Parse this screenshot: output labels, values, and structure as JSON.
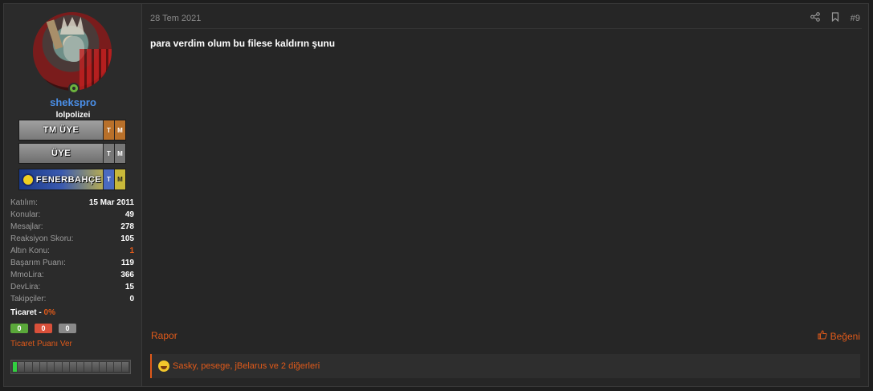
{
  "post": {
    "date": "28 Tem 2021",
    "number": "#9",
    "content": "para verdim olum bu filese kaldırın şunu",
    "report_label": "Rapor",
    "like_label": "Beğeni",
    "reactions_text": "Sasky, pesege, jBelarus ve 2 diğerleri"
  },
  "user": {
    "name": "shekspro",
    "title": "lolpolizei",
    "online": true,
    "banners": [
      {
        "label": "TM ÜYE",
        "t": "T",
        "m": "M"
      },
      {
        "label": "ÜYE",
        "t": "T",
        "m": "M"
      },
      {
        "label": "FENERBAHÇE",
        "t": "T",
        "m": "M"
      }
    ],
    "stats": [
      {
        "label": "Katılım:",
        "value": "15 Mar 2011"
      },
      {
        "label": "Konular:",
        "value": "49"
      },
      {
        "label": "Mesajlar:",
        "value": "278"
      },
      {
        "label": "Reaksiyon Skoru:",
        "value": "105"
      },
      {
        "label": "Altın Konu:",
        "value": "1"
      },
      {
        "label": "Başarım Puanı:",
        "value": "119"
      },
      {
        "label": "MmoLira:",
        "value": "366"
      },
      {
        "label": "DevLira:",
        "value": "15"
      },
      {
        "label": "Takipçiler:",
        "value": "0"
      }
    ],
    "trade": {
      "label": "Ticaret",
      "separator": "-",
      "percent": "0%",
      "positive": "0",
      "negative": "0",
      "neutral": "0",
      "give_rating_label": "Ticaret Puanı Ver"
    },
    "level_progress_fraction": 0.06
  },
  "colors": {
    "accent": "#e05a1a",
    "username": "#4a8fe8",
    "online": "#6cb33e"
  },
  "icons": {
    "share": "share-icon",
    "bookmark": "bookmark-icon",
    "like": "thumbs-up-icon",
    "reaction": "laughing-emoji-icon"
  }
}
